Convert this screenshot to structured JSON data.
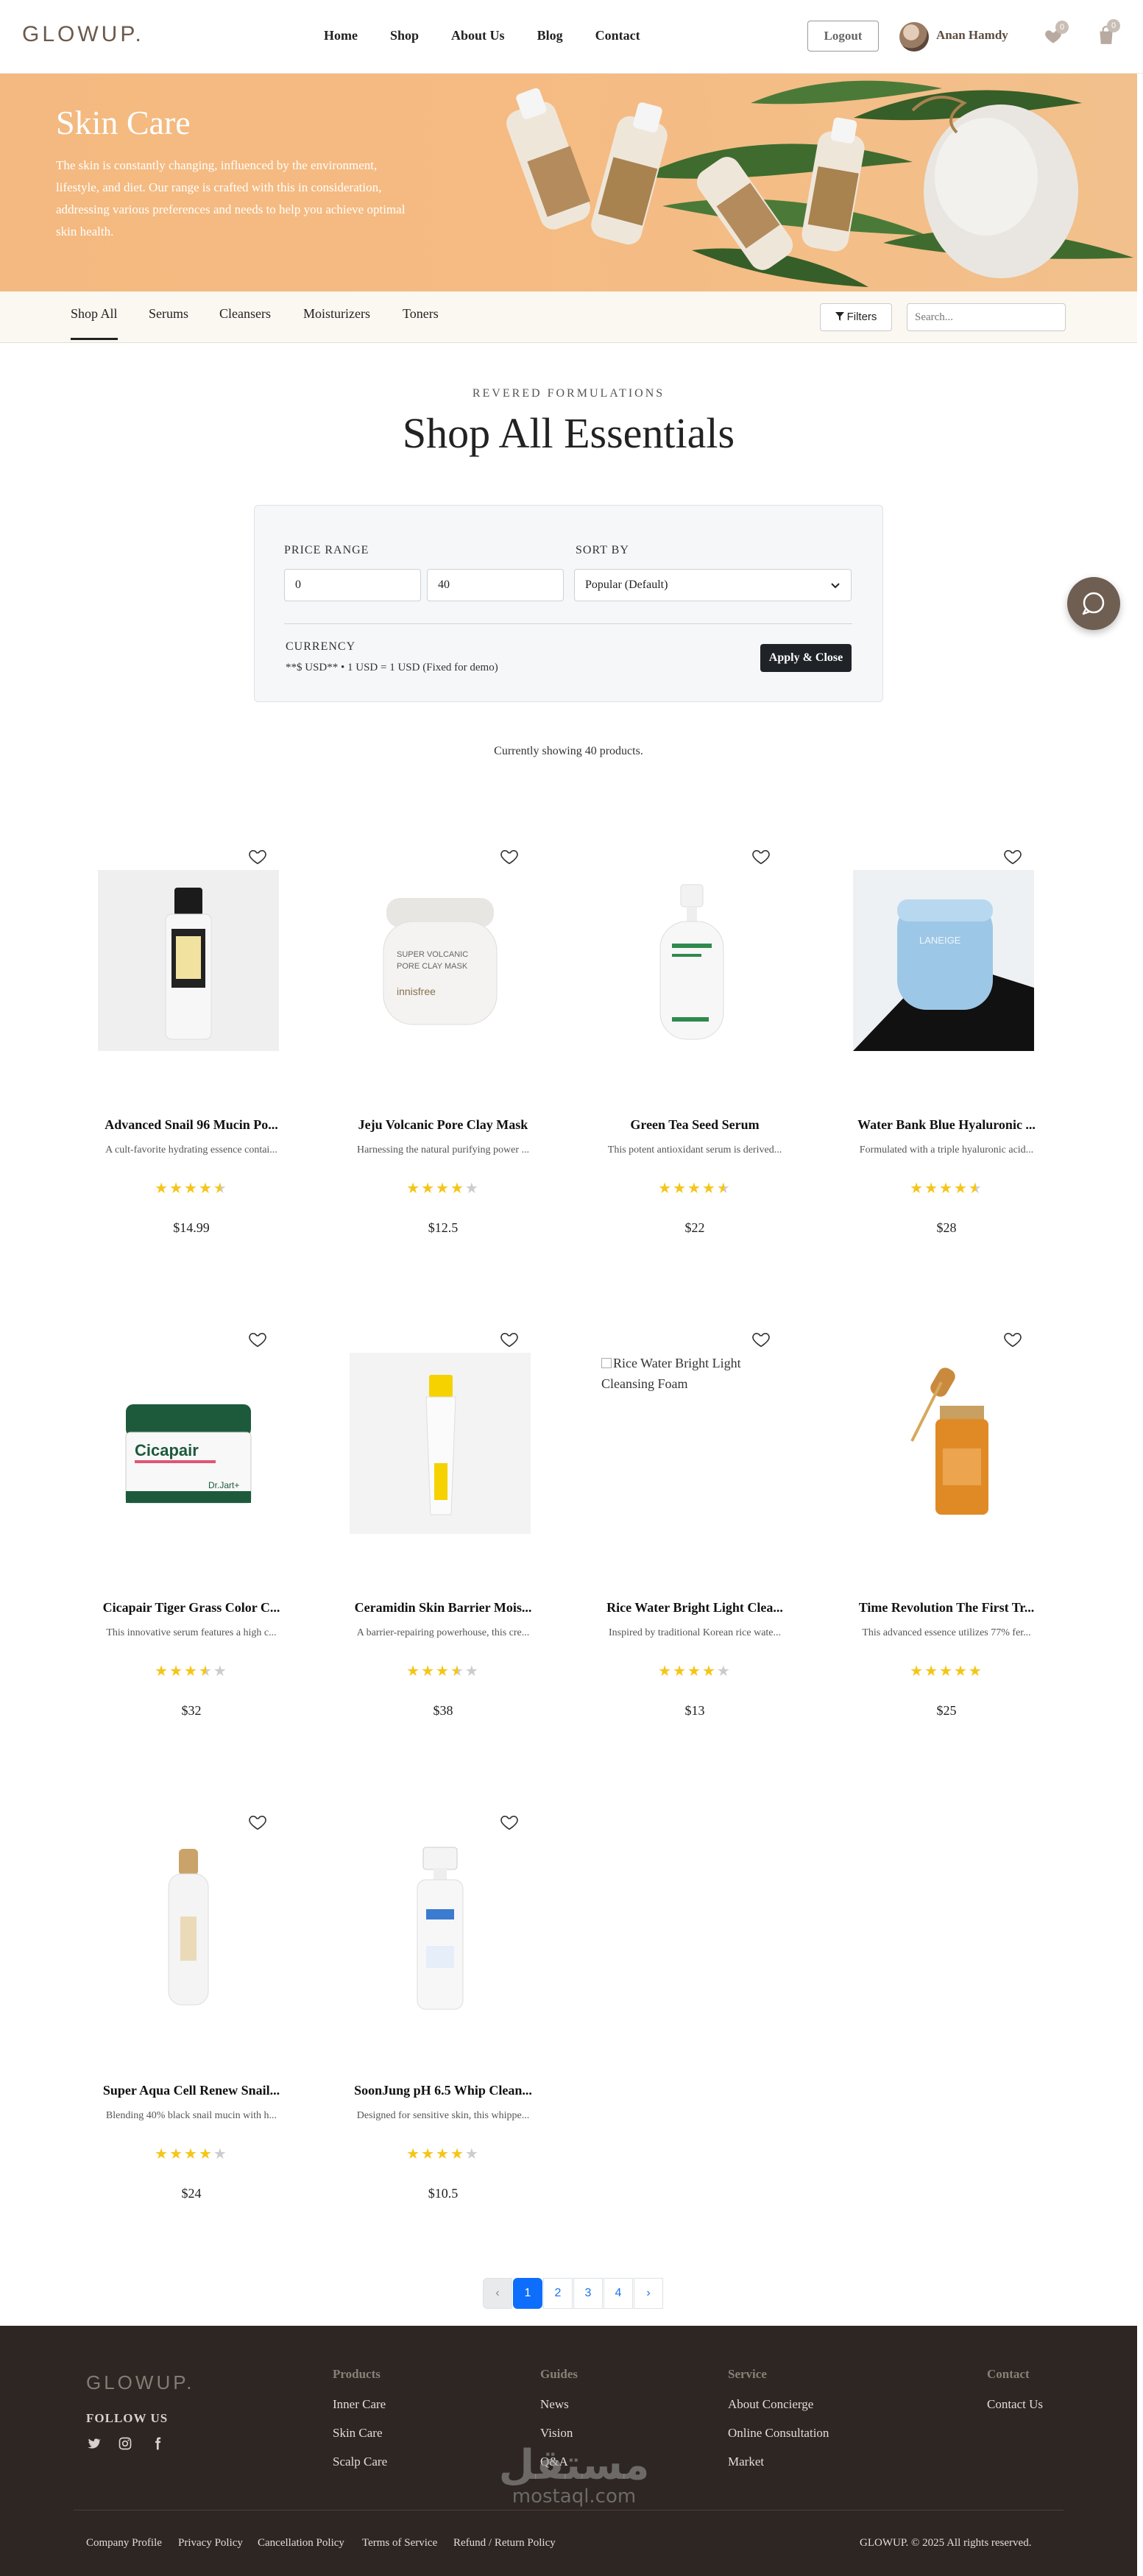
{
  "header": {
    "logo": "GLOWUP.",
    "nav": [
      "Home",
      "Shop",
      "About Us",
      "Blog",
      "Contact"
    ],
    "logout_label": "Logout",
    "user_name": "Anan Hamdy",
    "wishlist_count": "0",
    "cart_count": "0"
  },
  "hero": {
    "title": "Skin Care",
    "description": "The skin is constantly changing, influenced by the environment, lifestyle, and diet. Our range is crafted with this in consideration, addressing various preferences and needs to help you achieve optimal skin health."
  },
  "categories": {
    "tabs": [
      "Shop All",
      "Serums",
      "Cleansers",
      "Moisturizers",
      "Toners"
    ],
    "active": "Shop All",
    "filters_label": "Filters",
    "search_placeholder": "Search..."
  },
  "section": {
    "eyebrow": "REVERED FORMULATIONS",
    "title": "Shop All Essentials"
  },
  "filter_panel": {
    "price_label": "PRICE RANGE",
    "price_min": "0",
    "price_max": "40",
    "sort_label": "SORT BY",
    "sort_value": "Popular (Default)",
    "currency_label": "CURRENCY",
    "currency_note": "**$ USD** • 1 USD = 1 USD (Fixed for demo)",
    "apply_label": "Apply & Close"
  },
  "showing_text": "Currently showing 40 products.",
  "products": [
    {
      "name": "Advanced Snail 96 Mucin Po...",
      "desc": "A cult-favorite hydrating essence contai...",
      "rating": 4.5,
      "price": "$14.99",
      "image": "snail-essence-bottle"
    },
    {
      "name": "Jeju Volcanic Pore Clay Mask",
      "desc": "Harnessing the natural purifying power ...",
      "rating": 4,
      "price": "$12.5",
      "image": "clay-mask-jar"
    },
    {
      "name": "Green Tea Seed Serum",
      "desc": "This potent antioxidant serum is derived...",
      "rating": 4.5,
      "price": "$22",
      "image": "green-tea-serum-bottle"
    },
    {
      "name": "Water Bank Blue Hyaluronic ...",
      "desc": "Formulated with a triple hyaluronic acid...",
      "rating": 4.5,
      "price": "$28",
      "image": "blue-cream-jar"
    },
    {
      "name": "Cicapair Tiger Grass Color C...",
      "desc": "This innovative serum features a high c...",
      "rating": 3.5,
      "price": "$32",
      "image": "cicapair-jar",
      "jar_label": "Cicapair",
      "jar_brand": "Dr.Jart+"
    },
    {
      "name": "Ceramidin Skin Barrier Mois...",
      "desc": "A barrier-repairing powerhouse, this cre...",
      "rating": 3.5,
      "price": "$38",
      "image": "ceramidin-tube"
    },
    {
      "name": "Rice Water Bright Light Clea...",
      "desc": "Inspired by traditional Korean rice wate...",
      "rating": 4,
      "price": "$13",
      "image": "broken",
      "alt": "Rice Water Bright Light Cleansing Foam"
    },
    {
      "name": "Time Revolution The First Tr...",
      "desc": "This advanced essence utilizes 77% fer...",
      "rating": 5,
      "price": "$25",
      "image": "amber-dropper-bottle"
    },
    {
      "name": "Super Aqua Cell Renew Snail...",
      "desc": "Blending 40% black snail mucin with h...",
      "rating": 4,
      "price": "$24",
      "image": "aqua-snail-bottle"
    },
    {
      "name": "SoonJung pH 6.5 Whip Clean...",
      "desc": "Designed for sensitive skin, this whippe...",
      "rating": 4,
      "price": "$10.5",
      "image": "whip-cleanser-pump"
    }
  ],
  "pagination": {
    "prev": "‹",
    "pages": [
      "1",
      "2",
      "3",
      "4"
    ],
    "current": "1",
    "next": "›"
  },
  "footer": {
    "logo": "GLOWUP.",
    "follow_label": "FOLLOW US",
    "columns": [
      {
        "heading": "Products",
        "links": [
          "Inner Care",
          "Skin Care",
          "Scalp Care"
        ]
      },
      {
        "heading": "Guides",
        "links": [
          "News",
          "Vision",
          "Q&A"
        ]
      },
      {
        "heading": "Service",
        "links": [
          "About Concierge",
          "Online Consultation",
          "Market"
        ]
      },
      {
        "heading": "Contact",
        "links": [
          "Contact Us"
        ]
      }
    ],
    "bottom_links": [
      "Company Profile",
      "Privacy Policy",
      "Cancellation Policy",
      "Terms of Service",
      "Refund / Return Policy"
    ],
    "copyright": "GLOWUP. © 2025 All rights reserved.",
    "watermark_ar": "مستقل",
    "watermark_lat": "mostaql.com"
  },
  "colors": {
    "brand": "#6b5a4d",
    "hero_bg": "#f5bb82",
    "star": "#f5c518",
    "footer_bg": "#2d2623",
    "accent_blue": "#0d6efd"
  }
}
